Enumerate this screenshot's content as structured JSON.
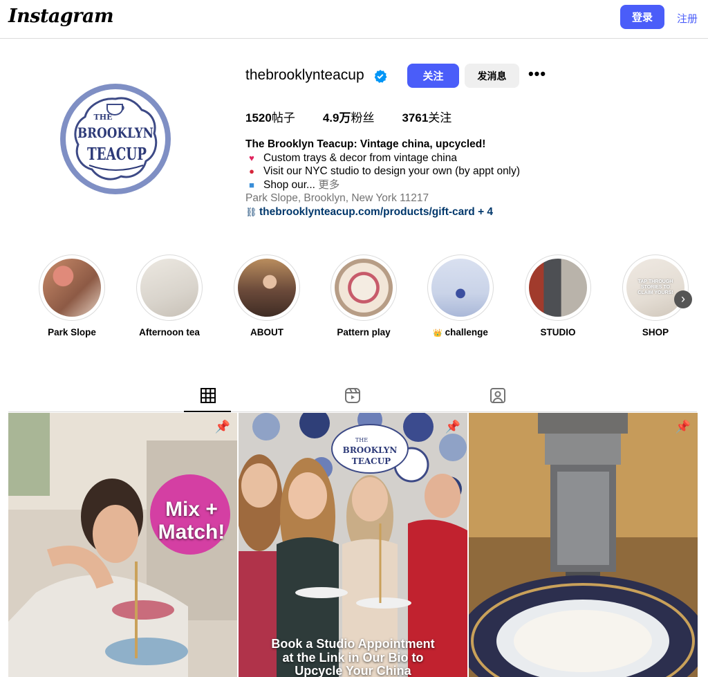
{
  "topbar": {
    "logo": "Instagram",
    "login_label": "登录",
    "signup_label": "注册"
  },
  "profile": {
    "username": "thebrooklynteacup",
    "follow_label": "关注",
    "message_label": "发消息",
    "more_label": "•••",
    "avatar_text": [
      "THE",
      "BROOKLYN",
      "TEACUP"
    ],
    "stats": {
      "posts_count": "1520",
      "posts_label": "帖子",
      "followers_count": "4.9万",
      "followers_label": "粉丝",
      "following_count": "3761",
      "following_label": "关注"
    },
    "bio": {
      "title": "The Brooklyn Teacup: Vintage china, upcycled!",
      "line1": "Custom trays & decor from vintage china",
      "line2": "Visit our NYC studio to design your own (by appt only)",
      "line3": "Shop our...",
      "more_label": "更多",
      "location": "Park Slope, Brooklyn, New York 11217",
      "link": "thebrooklynteacup.com/products/gift-card",
      "link_extra": "+ 4"
    }
  },
  "highlights": [
    {
      "label": "Park Slope",
      "color": "#c98b6a"
    },
    {
      "label": "Afternoon tea",
      "color": "#d9d4cc"
    },
    {
      "label": "ABOUT",
      "color": "#6b4a3a"
    },
    {
      "label": "Pattern play",
      "color": "#d8c3b0"
    },
    {
      "label": "challenge",
      "prefix": "👑",
      "color": "#c9d3e8"
    },
    {
      "label": "STUDIO",
      "color": "#8b8f93"
    },
    {
      "label": "SHOP",
      "color": "#e4ddd4"
    }
  ],
  "highlight_overlays": {
    "shop": "TAP THROUGH STORIES TO CLAIM YOURS!"
  },
  "tabs": {
    "posts": "grid-icon",
    "reels": "reels-icon",
    "tagged": "tagged-icon"
  },
  "posts": {
    "post1_overlay": [
      "Mix +",
      "Match!"
    ],
    "post2_overlay": [
      "Book a Studio Appointment",
      "at the Link in Our Bio to",
      "Upcycle Your China"
    ],
    "post2_sign": [
      "THE",
      "BROOKLYN",
      "TEACUP"
    ]
  },
  "colors": {
    "accent": "#4a5df9",
    "link": "#00376b",
    "muted": "#737373",
    "divider": "#dbdbdb"
  }
}
